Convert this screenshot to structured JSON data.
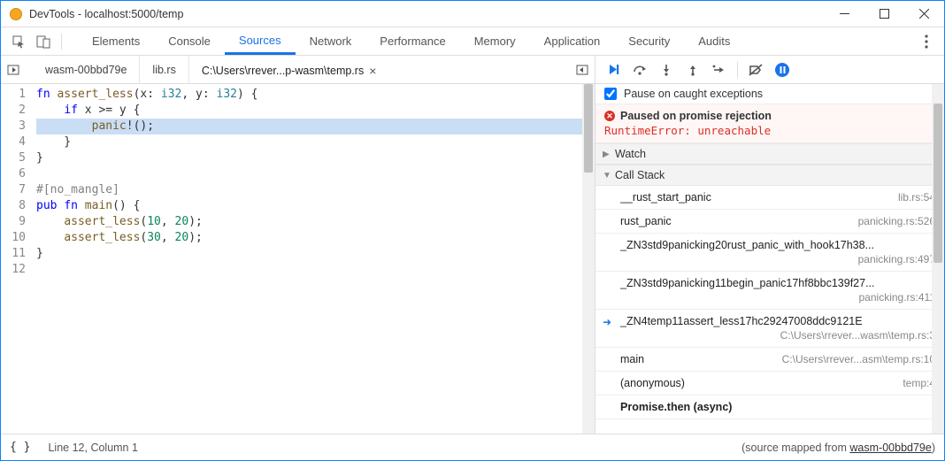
{
  "window": {
    "title": "DevTools - localhost:5000/temp"
  },
  "tabs": [
    {
      "label": "Elements",
      "active": false
    },
    {
      "label": "Console",
      "active": false
    },
    {
      "label": "Sources",
      "active": true
    },
    {
      "label": "Network",
      "active": false
    },
    {
      "label": "Performance",
      "active": false
    },
    {
      "label": "Memory",
      "active": false
    },
    {
      "label": "Application",
      "active": false
    },
    {
      "label": "Security",
      "active": false
    },
    {
      "label": "Audits",
      "active": false
    }
  ],
  "file_tabs": [
    {
      "label": "wasm-00bbd79e",
      "active": false,
      "closable": false
    },
    {
      "label": "lib.rs",
      "active": false,
      "closable": false
    },
    {
      "label": "C:\\Users\\rrever...p-wasm\\temp.rs",
      "active": true,
      "closable": true
    }
  ],
  "code": {
    "highlighted_line": 3,
    "lines": [
      {
        "num": 1,
        "raw": "fn assert_less(x: i32, y: i32) {"
      },
      {
        "num": 2,
        "raw": "    if x >= y {"
      },
      {
        "num": 3,
        "raw": "        panic!();"
      },
      {
        "num": 4,
        "raw": "    }"
      },
      {
        "num": 5,
        "raw": "}"
      },
      {
        "num": 6,
        "raw": ""
      },
      {
        "num": 7,
        "raw": "#[no_mangle]"
      },
      {
        "num": 8,
        "raw": "pub fn main() {"
      },
      {
        "num": 9,
        "raw": "    assert_less(10, 20);"
      },
      {
        "num": 10,
        "raw": "    assert_less(30, 20);"
      },
      {
        "num": 11,
        "raw": "}"
      },
      {
        "num": 12,
        "raw": ""
      }
    ]
  },
  "pause_on_caught": {
    "checked": true,
    "label": "Pause on caught exceptions"
  },
  "paused": {
    "title": "Paused on promise rejection",
    "message": "RuntimeError: unreachable"
  },
  "sections": {
    "watch": "Watch",
    "callstack": "Call Stack"
  },
  "callstack": [
    {
      "fn": "__rust_start_panic",
      "loc": "lib.rs:54",
      "layout": "short",
      "current": false
    },
    {
      "fn": "rust_panic",
      "loc": "panicking.rs:526",
      "layout": "short",
      "current": false
    },
    {
      "fn": "_ZN3std9panicking20rust_panic_with_hook17h38...",
      "loc": "panicking.rs:497",
      "layout": "two",
      "current": false
    },
    {
      "fn": "_ZN3std9panicking11begin_panic17hf8bbc139f27...",
      "loc": "panicking.rs:411",
      "layout": "two",
      "current": false
    },
    {
      "fn": "_ZN4temp11assert_less17hc29247008ddc9121E",
      "loc": "C:\\Users\\rrever...wasm\\temp.rs:3",
      "layout": "two",
      "current": true
    },
    {
      "fn": "main",
      "loc": "C:\\Users\\rrever...asm\\temp.rs:10",
      "layout": "short",
      "current": false
    },
    {
      "fn": "(anonymous)",
      "loc": "temp:4",
      "layout": "short",
      "current": false
    }
  ],
  "async_label": "Promise.then (async)",
  "status": {
    "cursor": "Line 12, Column 1",
    "mapped_prefix": "(source mapped from ",
    "mapped_link": "wasm-00bbd79e",
    "mapped_suffix": ")"
  }
}
